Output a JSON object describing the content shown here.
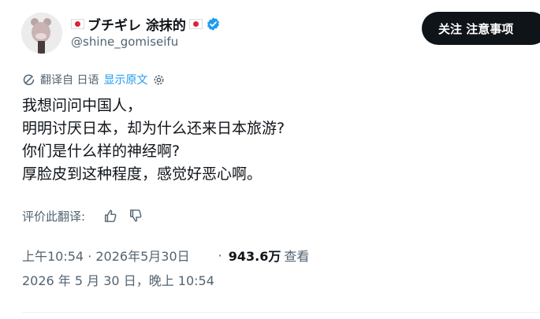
{
  "author": {
    "display_name": "ブチギレ 涂抹的",
    "handle": "@shine_gomiseifu",
    "verified": true,
    "flag_icon": "japan-flag-icon",
    "verified_icon": "verified-badge-icon",
    "accent_color": "#1d9bf0"
  },
  "follow_button": {
    "label": "关注 注意事项"
  },
  "translation": {
    "source_label": "翻译自 日语",
    "show_original_label": "显示原文",
    "translate_icon": "translate-icon",
    "settings_icon": "gear-icon"
  },
  "post": {
    "lines": [
      "我想问问中国人，",
      "明明讨厌日本，却为什么还来日本旅游?",
      "你们是什么样的神经啊?",
      "厚脸皮到这种程度，感觉好恶心啊。"
    ]
  },
  "rating": {
    "label": "评价此翻译:",
    "thumb_up_icon": "thumbs-up-icon",
    "thumb_down_icon": "thumbs-down-icon"
  },
  "meta": {
    "time": "上午10:54 · 2026年5月30日",
    "views_separator": "·",
    "views_count": "943.6万",
    "views_label": "查看",
    "original_time": "2026 年 5 月 30 日，晚上 10:54"
  },
  "colors": {
    "text_primary": "#0f1419",
    "text_secondary": "#536471",
    "link": "#1d9bf0",
    "button_bg": "#0f1419",
    "flag_red": "#e0203a"
  }
}
